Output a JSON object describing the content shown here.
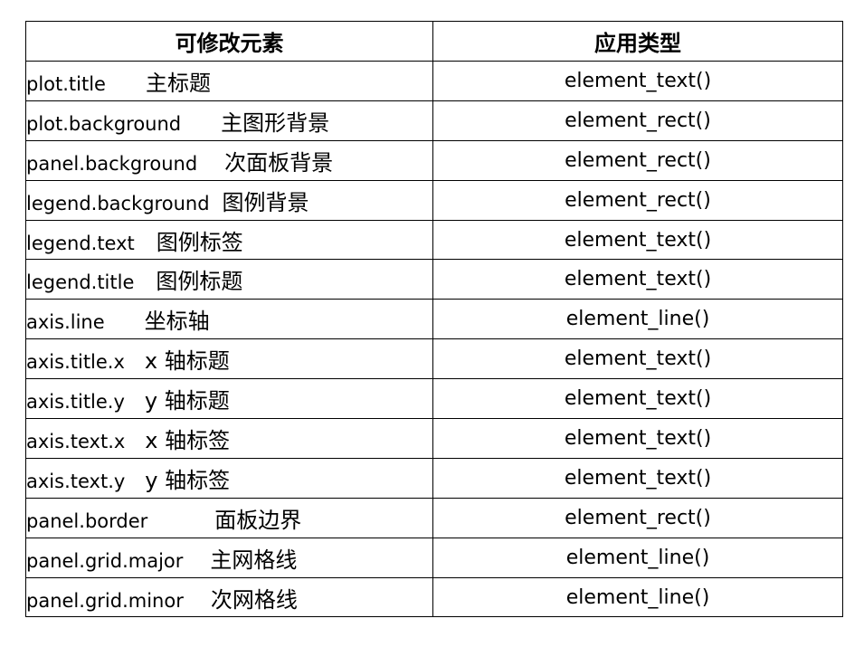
{
  "table": {
    "headers": [
      "可修改元素",
      "应用类型"
    ],
    "rows": [
      {
        "element": "plot.title",
        "desc": "主标题",
        "gap": 44,
        "type": "element_text()"
      },
      {
        "element": "plot.background",
        "desc": "主图形背景",
        "gap": 44,
        "type": "element_rect()"
      },
      {
        "element": "panel.background",
        "desc": "次面板背景",
        "gap": 30,
        "type": "element_rect()"
      },
      {
        "element": "legend.background",
        "desc": "图例背景",
        "gap": 14,
        "type": "element_rect()"
      },
      {
        "element": "legend.text",
        "desc": "图例标签",
        "gap": 24,
        "type": "element_text()"
      },
      {
        "element": "legend.title",
        "desc": "图例标题",
        "gap": 24,
        "type": "element_text()"
      },
      {
        "element": "axis.line",
        "desc": "坐标轴",
        "gap": 44,
        "type": "element_line()"
      },
      {
        "element": "axis.title.x",
        "desc": "x 轴标题",
        "gap": 22,
        "type": "element_text()"
      },
      {
        "element": "axis.title.y",
        "desc": "y 轴标题",
        "gap": 22,
        "type": "element_text()"
      },
      {
        "element": "axis.text.x",
        "desc": "x 轴标签",
        "gap": 22,
        "type": "element_text()"
      },
      {
        "element": "axis.text.y",
        "desc": "y 轴标签",
        "gap": 22,
        "type": "element_text()"
      },
      {
        "element": "panel.border",
        "desc": "面板边界",
        "gap": 74,
        "type": "element_rect()"
      },
      {
        "element": "panel.grid.major",
        "desc": "主网格线",
        "gap": 30,
        "type": "element_line()"
      },
      {
        "element": "panel.grid.minor",
        "desc": "次网格线",
        "gap": 30,
        "type": "element_line()"
      }
    ]
  }
}
